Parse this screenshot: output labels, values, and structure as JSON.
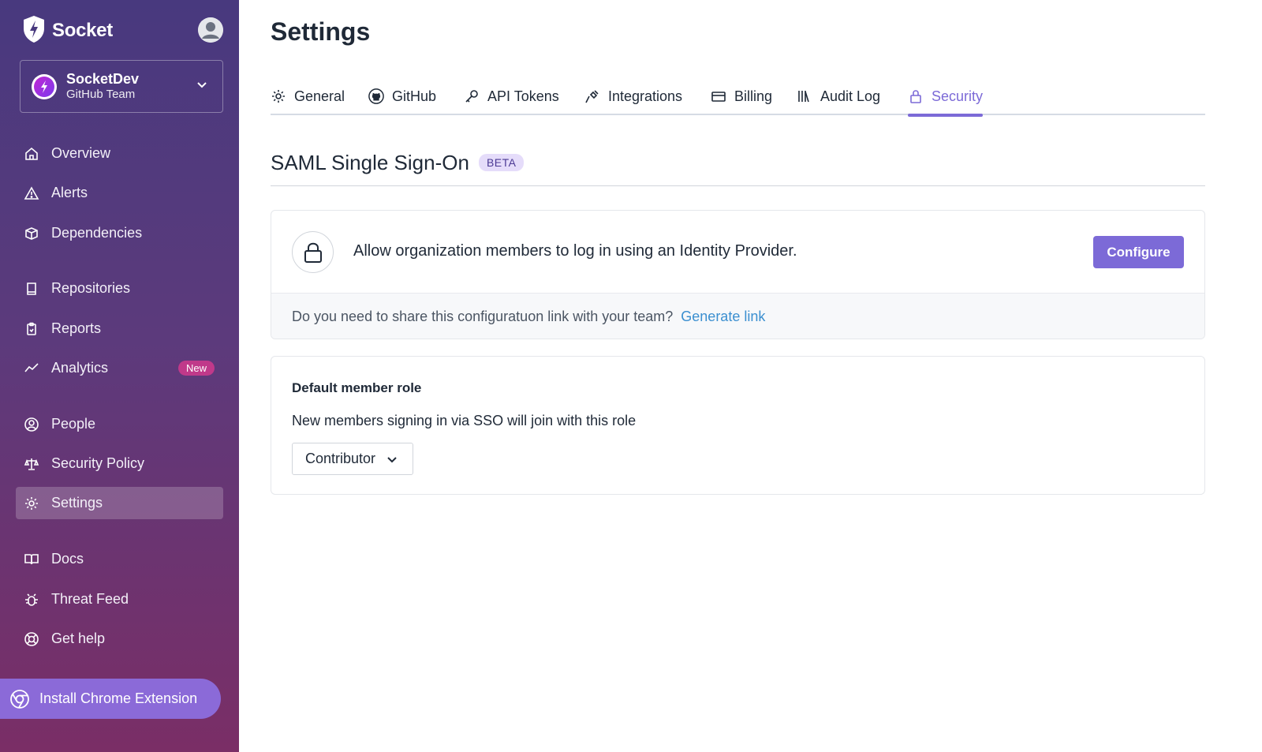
{
  "sidebar": {
    "brand": "Socket",
    "org": {
      "name": "SocketDev",
      "subtitle": "GitHub Team"
    },
    "items": [
      {
        "label": "Overview",
        "icon": "home-icon"
      },
      {
        "label": "Alerts",
        "icon": "warning-icon"
      },
      {
        "label": "Dependencies",
        "icon": "package-icon"
      },
      {
        "label": "Repositories",
        "icon": "book-icon"
      },
      {
        "label": "Reports",
        "icon": "clipboard-icon"
      },
      {
        "label": "Analytics",
        "icon": "trend-icon",
        "badge": "New"
      },
      {
        "label": "People",
        "icon": "user-circle-icon"
      },
      {
        "label": "Security Policy",
        "icon": "scale-icon"
      },
      {
        "label": "Settings",
        "icon": "gear-icon",
        "active": true
      },
      {
        "label": "Docs",
        "icon": "open-book-icon"
      },
      {
        "label": "Threat Feed",
        "icon": "bug-icon"
      },
      {
        "label": "Get help",
        "icon": "lifebuoy-icon"
      }
    ],
    "chrome_extension": "Install Chrome Extension"
  },
  "header": {
    "title": "Settings"
  },
  "tabs": [
    {
      "label": "General",
      "icon": "gear-icon"
    },
    {
      "label": "GitHub",
      "icon": "github-icon"
    },
    {
      "label": "API Tokens",
      "icon": "key-icon"
    },
    {
      "label": "Integrations",
      "icon": "plug-icon"
    },
    {
      "label": "Billing",
      "icon": "credit-card-icon"
    },
    {
      "label": "Audit Log",
      "icon": "library-icon"
    },
    {
      "label": "Security",
      "icon": "lock-icon",
      "active": true
    }
  ],
  "saml": {
    "title": "SAML Single Sign-On",
    "badge": "BETA",
    "description": "Allow organization members to log in using an Identity Provider.",
    "configure_label": "Configure",
    "share_question": "Do you need to share this configuratuon link with your team?",
    "generate_link": "Generate link"
  },
  "default_role": {
    "title": "Default member role",
    "description": "New members signing in via SSO will join with this role",
    "selected": "Contributor"
  },
  "colors": {
    "accent": "#7c6ad7",
    "link": "#3b8fd0",
    "sidebar_top": "#48397e",
    "sidebar_bottom": "#7a2e66",
    "new_badge": "#c0398a"
  }
}
